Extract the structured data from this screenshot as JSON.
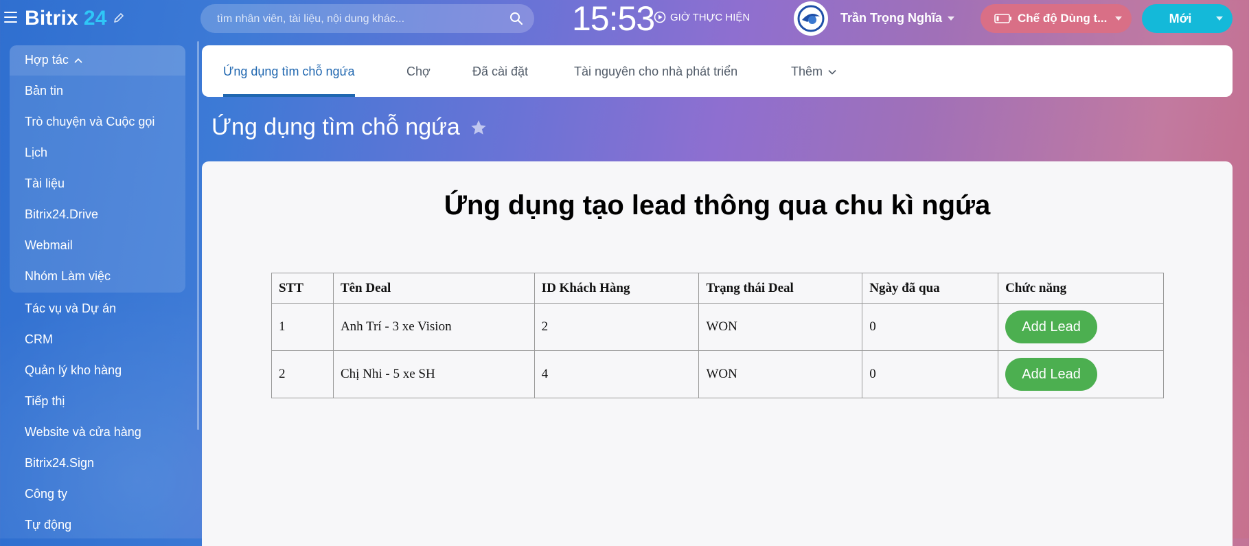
{
  "header": {
    "logo_text": "Bitrix",
    "logo_number": "24",
    "search_placeholder": "tìm nhân viên, tài liệu, nội dung khác...",
    "clock": "15:53",
    "realtime_label": "GIỜ THỰC HIỆN",
    "user_name": "Trần Trọng Nghĩa",
    "mode_label": "Chế độ Dùng t...",
    "new_label": "Mới"
  },
  "sidebar": {
    "group_label": "Hợp tác",
    "items": [
      {
        "label": "Bản tin"
      },
      {
        "label": "Trò chuyện và Cuộc gọi"
      },
      {
        "label": "Lịch"
      },
      {
        "label": "Tài liệu"
      },
      {
        "label": "Bitrix24.Drive"
      },
      {
        "label": "Webmail"
      },
      {
        "label": "Nhóm Làm việc"
      },
      {
        "label": "Tác vụ và Dự án"
      },
      {
        "label": "CRM"
      },
      {
        "label": "Quản lý kho hàng"
      },
      {
        "label": "Tiếp thị"
      },
      {
        "label": "Website và cửa hàng"
      },
      {
        "label": "Bitrix24.Sign"
      },
      {
        "label": "Công ty"
      },
      {
        "label": "Tự động"
      }
    ]
  },
  "tabs": [
    {
      "label": "Ứng dụng tìm chỗ ngứa",
      "active": true
    },
    {
      "label": "Chợ"
    },
    {
      "label": "Đã cài đặt"
    },
    {
      "label": "Tài nguyên cho nhà phát triển"
    },
    {
      "label": "Thêm"
    }
  ],
  "page_title": "Ứng dụng tìm chỗ ngứa",
  "content": {
    "heading": "Ứng dụng tạo lead thông qua chu kì ngứa",
    "columns": [
      "STT",
      "Tên Deal",
      "ID Khách Hàng",
      "Trạng thái Deal",
      "Ngày đã qua",
      "Chức năng"
    ],
    "rows": [
      {
        "stt": "1",
        "deal": "Anh Trí - 3 xe Vision",
        "customer_id": "2",
        "status": "WON",
        "days": "0",
        "action": "Add Lead"
      },
      {
        "stt": "2",
        "deal": "Chị Nhi - 5 xe SH",
        "customer_id": "4",
        "status": "WON",
        "days": "0",
        "action": "Add Lead"
      }
    ]
  },
  "colors": {
    "accent": "#2067b0",
    "logo_number": "#2fc7f7",
    "add_lead_button": "#4caf50",
    "mode_button": "#d96f86",
    "new_button": "#14b9d9"
  }
}
